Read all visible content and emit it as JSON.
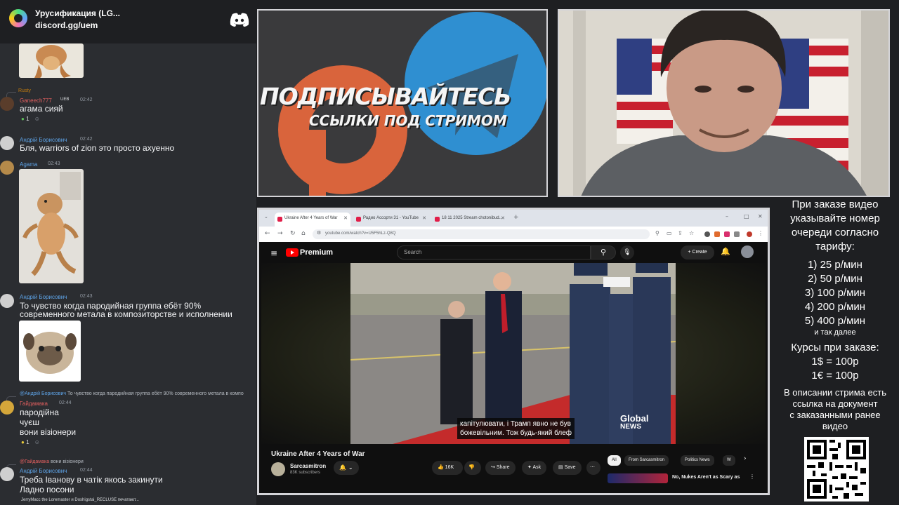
{
  "discord": {
    "server_name": "Урусификация (LG...",
    "invite": "discord.gg/uem",
    "messages": [
      {
        "author": "Rusty",
        "author_color": "#c27c0e",
        "role_label": "",
        "time": "",
        "text": ""
      },
      {
        "author": "Ganeech777",
        "badge": "UEB",
        "time": "02:42",
        "text": "агама сияй",
        "reaction_count": "1"
      },
      {
        "author": "Андрій Борисович",
        "time": "02:42",
        "text": "Бля, warriors of zion это просто ахуенно"
      },
      {
        "author": "Agama",
        "time": "02:43"
      },
      {
        "author": "Андрій Борисович",
        "time": "02:43",
        "text_line1": "То чувство когда пародийная группа ебёт 90%",
        "text_line2": "современного метала в композиторстве и исполнении"
      },
      {
        "reply_to": "@Андрій Борисович",
        "reply_text": "То чувство когда пародийная группа ебёт 90% современного метала в компо",
        "author": "Гайдамака",
        "time": "02:44",
        "lines": [
          "пародійна",
          "чуєш",
          "вони візіонери"
        ],
        "reaction_count": "1"
      },
      {
        "reply_to": "@Гайдамака",
        "reply_text": "вони візіонери",
        "author": "Андрій Борисович",
        "time": "02:44",
        "lines": [
          "Треба Іванову в чатік якось закинути",
          "Ладно посони"
        ]
      }
    ],
    "typing": "JerryMacc the Loremaster и Doshigstai_RECLUSE печатают..."
  },
  "promo": {
    "title": "ПОДПИСЫВАЙТЕСЬ",
    "subtitle": "ССЫЛКИ ПОД СТРИМОМ"
  },
  "browser": {
    "tabs": [
      "Ukraine After 4 Years of War",
      "Радио Ассорти 31 - YouTube",
      "18 11 2025 Stream chotonibud..."
    ],
    "url": "youtube.com/watch?v=U5F5hLz-Q8Q",
    "yt_brand": "Premium",
    "search_placeholder": "Search",
    "create_label": "Create",
    "caption_line1": "капітулювати, і Трамп явно не був",
    "caption_line2": "божевільним.  Тож будь-який блеф",
    "news_logo_line1": "Global",
    "news_logo_line2": "NEWS",
    "video_title": "Ukraine After 4 Years of War",
    "channel_name": "Sarcasmitron",
    "channel_subs": "83K subscribers",
    "likes": "16K",
    "share_label": "Share",
    "ask_label": "Ask",
    "save_label": "Save",
    "chips": [
      "All",
      "From Sarcasmitron",
      "Politics News",
      "W"
    ],
    "rec_title": "No, Nukes Aren't as Scary as"
  },
  "info": {
    "intro": [
      "При заказе видео",
      "указывайте номер",
      "очереди согласно",
      "тарифу:"
    ],
    "tariffs": [
      "1) 25 р/мин",
      "2) 50 р/мин",
      "3) 100 р/мин",
      "4) 200 р/мин",
      "5) 400 р/мин"
    ],
    "etc": "и так далее",
    "rates_title": "Курсы при заказе:",
    "rates": [
      "1$ = 100р",
      "1€ = 100р"
    ],
    "desc": [
      "В описании стрима есть",
      "ссылка на документ",
      "с заказанными ранее",
      "видео"
    ]
  },
  "colors": {
    "discord_bg": "#2b2d31",
    "discord_header": "#1e1f22",
    "username_blue": "#5ea4e8",
    "username_red": "#e35f5f",
    "youtube_red": "#ff0000"
  }
}
